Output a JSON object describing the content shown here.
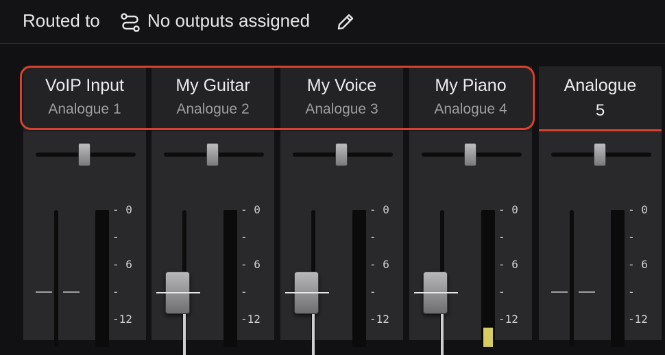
{
  "routing": {
    "label": "Routed to",
    "value": "No outputs assigned",
    "route_icon": "route-icon",
    "edit_icon": "pencil-icon"
  },
  "channels": [
    {
      "name": "VoIP Input",
      "source": "Analogue 1",
      "selected": false,
      "fader_zero": true,
      "meter_level": 0
    },
    {
      "name": "My Guitar",
      "source": "Analogue 2",
      "selected": false,
      "fader_zero": false,
      "meter_level": 0
    },
    {
      "name": "My Voice",
      "source": "Analogue 3",
      "selected": false,
      "fader_zero": false,
      "meter_level": 0
    },
    {
      "name": "My Piano",
      "source": "Analogue 4",
      "selected": false,
      "fader_zero": false,
      "meter_level": 0.14
    },
    {
      "name": "Analogue",
      "source": "5",
      "selected": true,
      "fader_zero": true,
      "meter_level": 0
    }
  ],
  "scale": {
    "ticks": [
      "- 0",
      "-",
      "- 6",
      "-",
      "-12"
    ]
  },
  "colors": {
    "highlight": "#d9412e",
    "meter": "#d6cc62"
  }
}
